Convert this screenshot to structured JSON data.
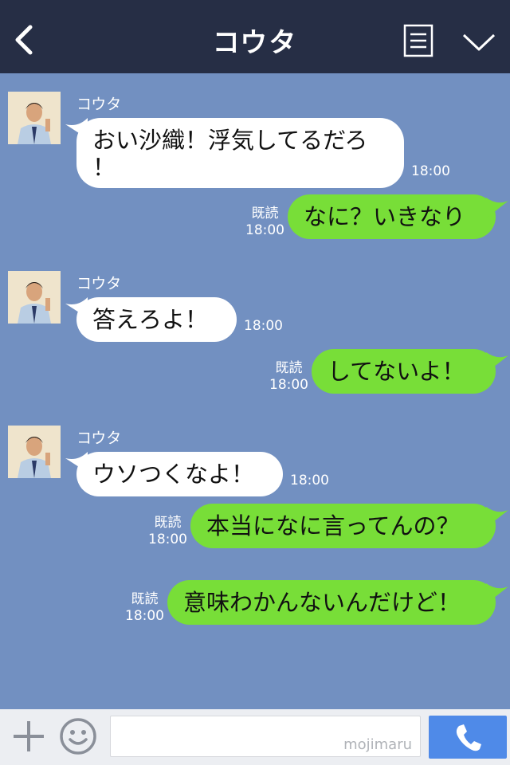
{
  "header": {
    "title": "コウタ"
  },
  "colors": {
    "header_bg": "#262e45",
    "chat_bg": "#7290c1",
    "incoming_bubble": "#ffffff",
    "outgoing_bubble": "#78de38",
    "call_button": "#4f8ae8"
  },
  "messages": [
    {
      "direction": "in",
      "sender": "コウタ",
      "line1": "おい沙織！浮気してるだろ",
      "line2": "！",
      "time": "18:00"
    },
    {
      "direction": "out",
      "text": "なに？いきなり",
      "read": "既読",
      "time": "18:00"
    },
    {
      "direction": "in",
      "sender": "コウタ",
      "text": "答えろよ！",
      "time": "18:00"
    },
    {
      "direction": "out",
      "text": "してないよ！",
      "read": "既読",
      "time": "18:00"
    },
    {
      "direction": "in",
      "sender": "コウタ",
      "text": "ウソつくなよ！",
      "time": "18:00"
    },
    {
      "direction": "out",
      "text": "本当になに言ってんの？",
      "read": "既読",
      "time": "18:00"
    },
    {
      "direction": "out",
      "text": "意味わかんないんだけど！",
      "read": "既読",
      "time": "18:00"
    }
  ],
  "footer": {
    "input_value": "",
    "watermark": "mojimaru"
  },
  "icons": [
    "back-icon",
    "menu-icon",
    "chevron-down-icon",
    "plus-icon",
    "emoji-icon",
    "phone-icon"
  ]
}
